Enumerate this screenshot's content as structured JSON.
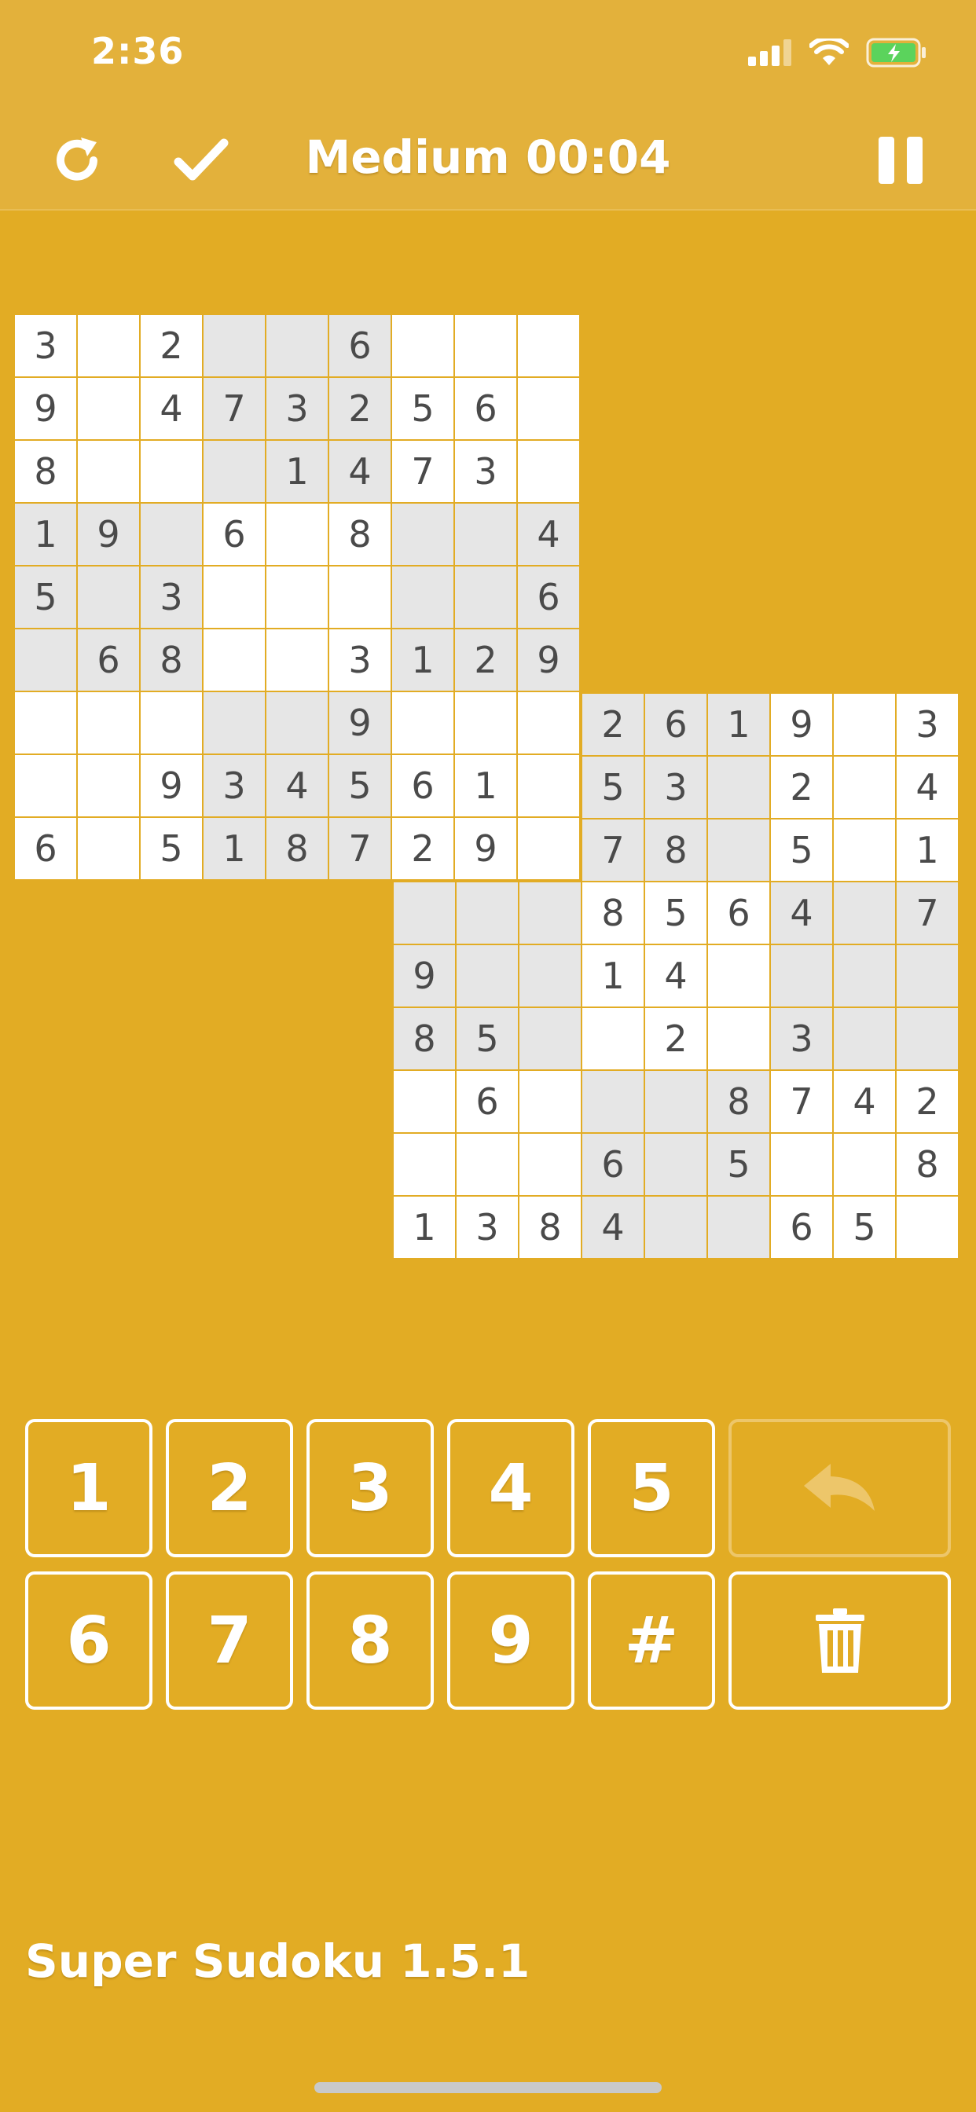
{
  "status_bar": {
    "time": "2:36"
  },
  "toolbar": {
    "title": "Medium 00:04",
    "icons": [
      "refresh-icon",
      "check-icon",
      "pause-icon"
    ]
  },
  "colors": {
    "background": "#E2AC24",
    "header": "#E3B13B",
    "cell_white": "#ffffff",
    "cell_gray": "#E6E6E6",
    "digit": "#4a4a4a"
  },
  "grid_a": [
    [
      "3",
      "",
      "2",
      "",
      "",
      "6",
      "",
      "",
      ""
    ],
    [
      "9",
      "",
      "4",
      "7",
      "3",
      "2",
      "5",
      "6",
      ""
    ],
    [
      "8",
      "",
      "",
      "",
      "1",
      "4",
      "7",
      "3",
      ""
    ],
    [
      "1",
      "9",
      "",
      "6",
      "",
      "8",
      "",
      "",
      "4"
    ],
    [
      "5",
      "",
      "3",
      "",
      "",
      "",
      "",
      "",
      "6"
    ],
    [
      "",
      "6",
      "8",
      "",
      "",
      "3",
      "1",
      "2",
      "9"
    ],
    [
      "",
      "",
      "",
      "",
      "",
      "9",
      "",
      "",
      ""
    ],
    [
      "",
      "",
      "9",
      "3",
      "4",
      "5",
      "6",
      "1",
      ""
    ],
    [
      "6",
      "",
      "5",
      "1",
      "8",
      "7",
      "2",
      "9",
      ""
    ]
  ],
  "grid_b": [
    [
      "",
      "",
      "",
      "2",
      "6",
      "1",
      "9",
      "",
      "3"
    ],
    [
      "",
      "",
      "",
      "5",
      "3",
      "",
      "2",
      "",
      "4"
    ],
    [
      "",
      "",
      "",
      "7",
      "8",
      "",
      "5",
      "",
      "1"
    ],
    [
      "",
      "",
      "",
      "8",
      "5",
      "6",
      "4",
      "",
      "7"
    ],
    [
      "9",
      "",
      "",
      "1",
      "4",
      "",
      "",
      "",
      ""
    ],
    [
      "8",
      "5",
      "",
      "",
      "2",
      "",
      "3",
      "",
      ""
    ],
    [
      "",
      "6",
      "",
      "",
      "",
      "8",
      "7",
      "4",
      "2"
    ],
    [
      "",
      "",
      "",
      "6",
      "",
      "5",
      "",
      "",
      "8"
    ],
    [
      "1",
      "3",
      "8",
      "4",
      "",
      "",
      "6",
      "5",
      ""
    ]
  ],
  "keypad": {
    "row1": [
      "1",
      "2",
      "3",
      "4",
      "5"
    ],
    "row2": [
      "6",
      "7",
      "8",
      "9",
      "#"
    ],
    "undo_icon": "undo-icon",
    "delete_icon": "trash-icon"
  },
  "footer": {
    "app_name": "Super Sudoku 1.5.1"
  }
}
